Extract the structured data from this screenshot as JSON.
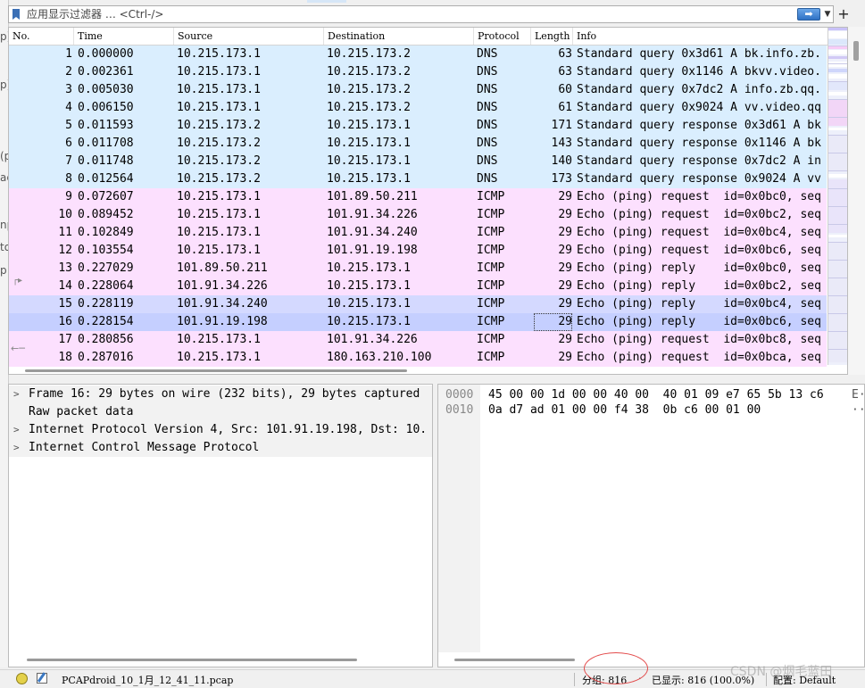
{
  "filter": {
    "placeholder": "应用显示过滤器 … <Ctrl-/>",
    "apply_icon": "arrow-right-icon",
    "add_label": "+"
  },
  "columns": [
    "No.",
    "Time",
    "Source",
    "Destination",
    "Protocol",
    "Length",
    "Info"
  ],
  "packets": [
    {
      "no": "1",
      "time": "0.000000",
      "src": "10.215.173.1",
      "dst": "10.215.173.2",
      "proto": "DNS",
      "len": "63",
      "info": "Standard query 0x3d61 A bk.info.zb.",
      "kind": "dns"
    },
    {
      "no": "2",
      "time": "0.002361",
      "src": "10.215.173.1",
      "dst": "10.215.173.2",
      "proto": "DNS",
      "len": "63",
      "info": "Standard query 0x1146 A bkvv.video.",
      "kind": "dns"
    },
    {
      "no": "3",
      "time": "0.005030",
      "src": "10.215.173.1",
      "dst": "10.215.173.2",
      "proto": "DNS",
      "len": "60",
      "info": "Standard query 0x7dc2 A info.zb.qq.",
      "kind": "dns"
    },
    {
      "no": "4",
      "time": "0.006150",
      "src": "10.215.173.1",
      "dst": "10.215.173.2",
      "proto": "DNS",
      "len": "61",
      "info": "Standard query 0x9024 A vv.video.qq",
      "kind": "dns"
    },
    {
      "no": "5",
      "time": "0.011593",
      "src": "10.215.173.2",
      "dst": "10.215.173.1",
      "proto": "DNS",
      "len": "171",
      "info": "Standard query response 0x3d61 A bk",
      "kind": "dns"
    },
    {
      "no": "6",
      "time": "0.011708",
      "src": "10.215.173.2",
      "dst": "10.215.173.1",
      "proto": "DNS",
      "len": "143",
      "info": "Standard query response 0x1146 A bk",
      "kind": "dns"
    },
    {
      "no": "7",
      "time": "0.011748",
      "src": "10.215.173.2",
      "dst": "10.215.173.1",
      "proto": "DNS",
      "len": "140",
      "info": "Standard query response 0x7dc2 A in",
      "kind": "dns"
    },
    {
      "no": "8",
      "time": "0.012564",
      "src": "10.215.173.2",
      "dst": "10.215.173.1",
      "proto": "DNS",
      "len": "173",
      "info": "Standard query response 0x9024 A vv",
      "kind": "dns"
    },
    {
      "no": "9",
      "time": "0.072607",
      "src": "10.215.173.1",
      "dst": "101.89.50.211",
      "proto": "ICMP",
      "len": "29",
      "info": "Echo (ping) request  id=0x0bc0, seq",
      "kind": "icmp"
    },
    {
      "no": "10",
      "time": "0.089452",
      "src": "10.215.173.1",
      "dst": "101.91.34.226",
      "proto": "ICMP",
      "len": "29",
      "info": "Echo (ping) request  id=0x0bc2, seq",
      "kind": "icmp"
    },
    {
      "no": "11",
      "time": "0.102849",
      "src": "10.215.173.1",
      "dst": "101.91.34.240",
      "proto": "ICMP",
      "len": "29",
      "info": "Echo (ping) request  id=0x0bc4, seq",
      "kind": "icmp"
    },
    {
      "no": "12",
      "time": "0.103554",
      "src": "10.215.173.1",
      "dst": "101.91.19.198",
      "proto": "ICMP",
      "len": "29",
      "info": "Echo (ping) request  id=0x0bc6, seq",
      "kind": "icmp"
    },
    {
      "no": "13",
      "time": "0.227029",
      "src": "101.89.50.211",
      "dst": "10.215.173.1",
      "proto": "ICMP",
      "len": "29",
      "info": "Echo (ping) reply    id=0x0bc0, seq",
      "kind": "icmp"
    },
    {
      "no": "14",
      "time": "0.228064",
      "src": "101.91.34.226",
      "dst": "10.215.173.1",
      "proto": "ICMP",
      "len": "29",
      "info": "Echo (ping) reply    id=0x0bc2, seq",
      "kind": "icmp"
    },
    {
      "no": "15",
      "time": "0.228119",
      "src": "101.91.34.240",
      "dst": "10.215.173.1",
      "proto": "ICMP",
      "len": "29",
      "info": "Echo (ping) reply    id=0x0bc4, seq",
      "kind": "icmp hl2"
    },
    {
      "no": "16",
      "time": "0.228154",
      "src": "101.91.19.198",
      "dst": "10.215.173.1",
      "proto": "ICMP",
      "len": "29",
      "info": "Echo (ping) reply    id=0x0bc6, seq",
      "kind": "icmp hl"
    },
    {
      "no": "17",
      "time": "0.280856",
      "src": "10.215.173.1",
      "dst": "101.91.34.226",
      "proto": "ICMP",
      "len": "29",
      "info": "Echo (ping) request  id=0x0bc8, seq",
      "kind": "icmp"
    },
    {
      "no": "18",
      "time": "0.287016",
      "src": "10.215.173.1",
      "dst": "180.163.210.100",
      "proto": "ICMP",
      "len": "29",
      "info": "Echo (ping) request  id=0x0bca, seq",
      "kind": "icmp"
    }
  ],
  "details": [
    {
      "expander": ">",
      "text": "Frame 16: 29 bytes on wire (232 bits), 29 bytes captured"
    },
    {
      "expander": "",
      "text": "Raw packet data"
    },
    {
      "expander": ">",
      "text": "Internet Protocol Version 4, Src: 101.91.19.198, Dst: 10."
    },
    {
      "expander": ">",
      "text": "Internet Control Message Protocol"
    }
  ],
  "bytes": [
    {
      "offset": "0000",
      "hex": "45 00 00 1d 00 00 40 00  40 01 09 e7 65 5b 13 c6",
      "ascii": "E·"
    },
    {
      "offset": "0010",
      "hex": "0a d7 ad 01 00 00 f4 38  0b c6 00 01 00",
      "ascii": "··"
    }
  ],
  "status": {
    "file_name": "PCAPdroid_10_1月_12_41_11.pcap",
    "packets": "分组: 816",
    "separator": "·",
    "displayed": "已显示: 816 (100.0%)",
    "profile": "配置: Default"
  },
  "watermark": "CSDN @烟毛蓝田",
  "colors": {
    "dns_row": "#daeefe",
    "icmp_row": "#fce0fe",
    "selected_row": "#c5cfff",
    "annotation_circle": "#e34b4b"
  }
}
